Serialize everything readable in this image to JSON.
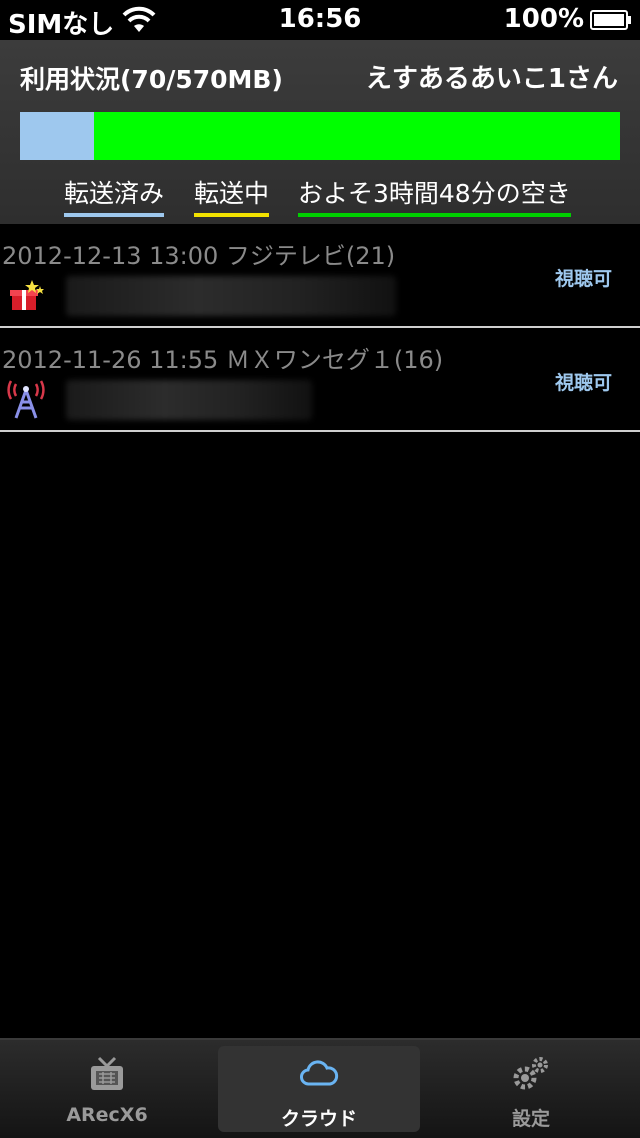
{
  "status_bar": {
    "carrier": "SIMなし",
    "time": "16:56",
    "battery": "100%"
  },
  "usage": {
    "title": "利用状況(70/570MB)",
    "user": "えすあるあいこ1さん",
    "used_fraction": 0.1228,
    "colors": {
      "done": "#9ec8ee",
      "doing": "#f2e200",
      "free": "#00ff00"
    },
    "legend": {
      "done": "転送済み",
      "doing": "転送中",
      "free": "およそ3時間48分の空き"
    }
  },
  "recordings": [
    {
      "meta": "2012-12-13 13:00 フジテレビ(21)",
      "icon": "gift-box-icon",
      "status": "視聴可"
    },
    {
      "meta": "2012-11-26 11:55 ＭＸワンセグ１(16)",
      "icon": "antenna-tower-icon",
      "status": "視聴可"
    }
  ],
  "tabs": [
    {
      "label": "ARecX6",
      "icon": "tv-icon",
      "selected": false
    },
    {
      "label": "クラウド",
      "icon": "cloud-icon",
      "selected": true
    },
    {
      "label": "設定",
      "icon": "gears-icon",
      "selected": false
    }
  ]
}
